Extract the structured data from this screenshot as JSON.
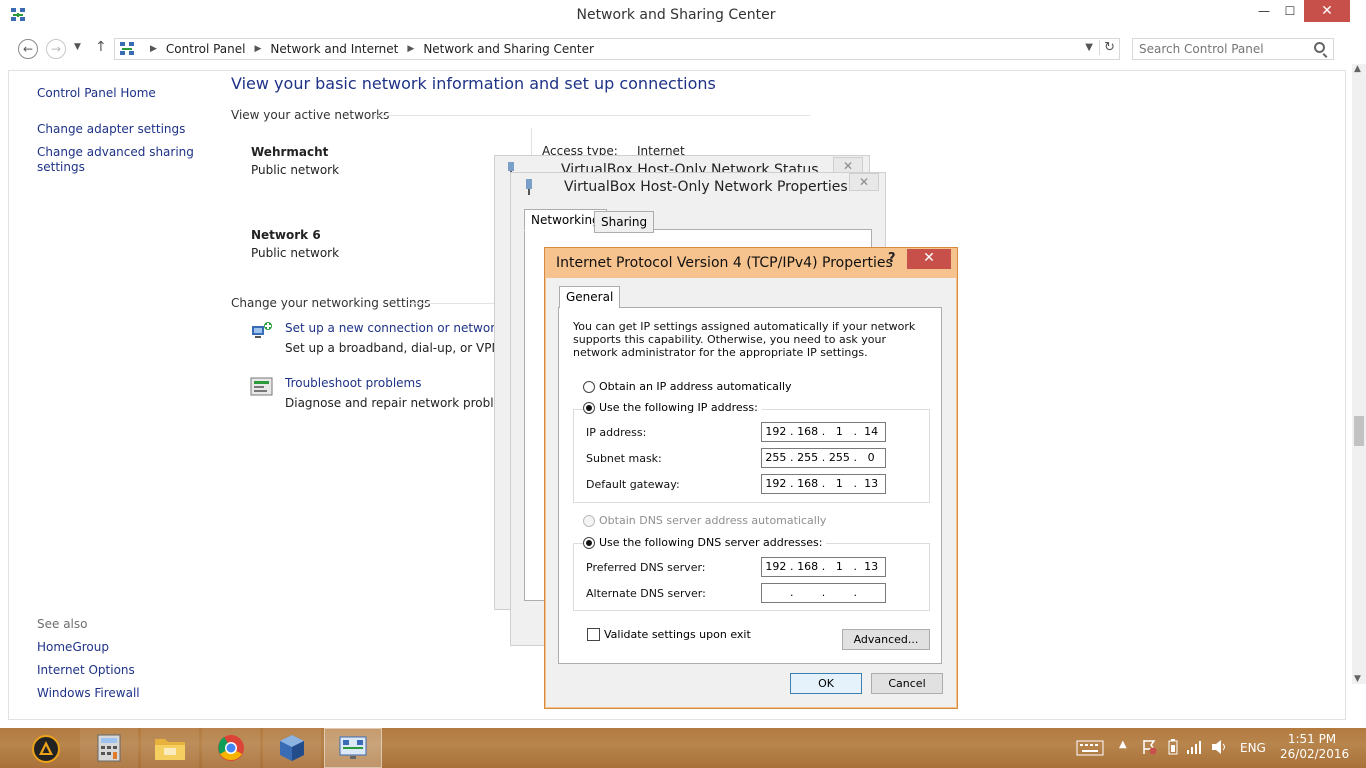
{
  "window": {
    "title": "Network and Sharing Center",
    "min": "—",
    "max": "☐",
    "close": "✕"
  },
  "address": {
    "crumbs": [
      "Control Panel",
      "Network and Internet",
      "Network and Sharing Center"
    ],
    "search_placeholder": "Search Control Panel"
  },
  "left_pane": {
    "home": "Control Panel Home",
    "links": [
      "Change adapter settings",
      "Change advanced sharing",
      "settings"
    ],
    "see_also_label": "See also",
    "see_also": [
      "HomeGroup",
      "Internet Options",
      "Windows Firewall"
    ]
  },
  "main": {
    "heading": "View your basic network information and set up connections",
    "active_networks_label": "View your active networks",
    "networks": [
      {
        "name": "Wehrmacht",
        "category": "Public network"
      },
      {
        "name": "Network  6",
        "category": "Public network"
      }
    ],
    "access_type_label": "Access type:",
    "access_type_value": "Internet",
    "change_settings_label": "Change your networking settings",
    "tasks": [
      {
        "link": "Set up a new connection or network",
        "desc": "Set up a broadband, dial-up, or VPN connection; or set up a router or access point."
      },
      {
        "link": "Troubleshoot problems",
        "desc": "Diagnose and repair network problems, or get troubleshooting information."
      }
    ]
  },
  "status_dialog": {
    "title": "VirtualBox Host-Only Network Status"
  },
  "props_dialog": {
    "title": "VirtualBox Host-Only Network Properties",
    "tabs": [
      "Networking",
      "Sharing"
    ]
  },
  "ipv4": {
    "title": "Internet Protocol Version 4 (TCP/IPv4) Properties",
    "help": "?",
    "close": "✕",
    "tab": "General",
    "intro": "You can get IP settings assigned automatically if your network supports this capability. Otherwise, you need to ask your network administrator for the appropriate IP settings.",
    "auto_ip": "Obtain an IP address automatically",
    "manual_ip": "Use the following IP address:",
    "ip_label": "IP address:",
    "ip": [
      "192",
      "168",
      "1",
      "14"
    ],
    "mask_label": "Subnet mask:",
    "mask": [
      "255",
      "255",
      "255",
      "0"
    ],
    "gateway_label": "Default gateway:",
    "gateway": [
      "192",
      "168",
      "1",
      "13"
    ],
    "auto_dns": "Obtain DNS server address automatically",
    "manual_dns": "Use the following DNS server addresses:",
    "pref_dns_label": "Preferred DNS server:",
    "pref_dns": [
      "192",
      "168",
      "1",
      "13"
    ],
    "alt_dns_label": "Alternate DNS server:",
    "alt_dns": [
      "",
      "",
      "",
      ""
    ],
    "validate": "Validate settings upon exit",
    "advanced": "Advanced...",
    "ok": "OK",
    "cancel": "Cancel"
  },
  "taskbar": {
    "lang": "ENG",
    "time": "1:51 PM",
    "date": "26/02/2016"
  },
  "colors": {
    "link": "#1e3287",
    "dialog_frame": "#f6c28d",
    "close_red": "#c7504a",
    "taskbar": "#b37a3f"
  }
}
